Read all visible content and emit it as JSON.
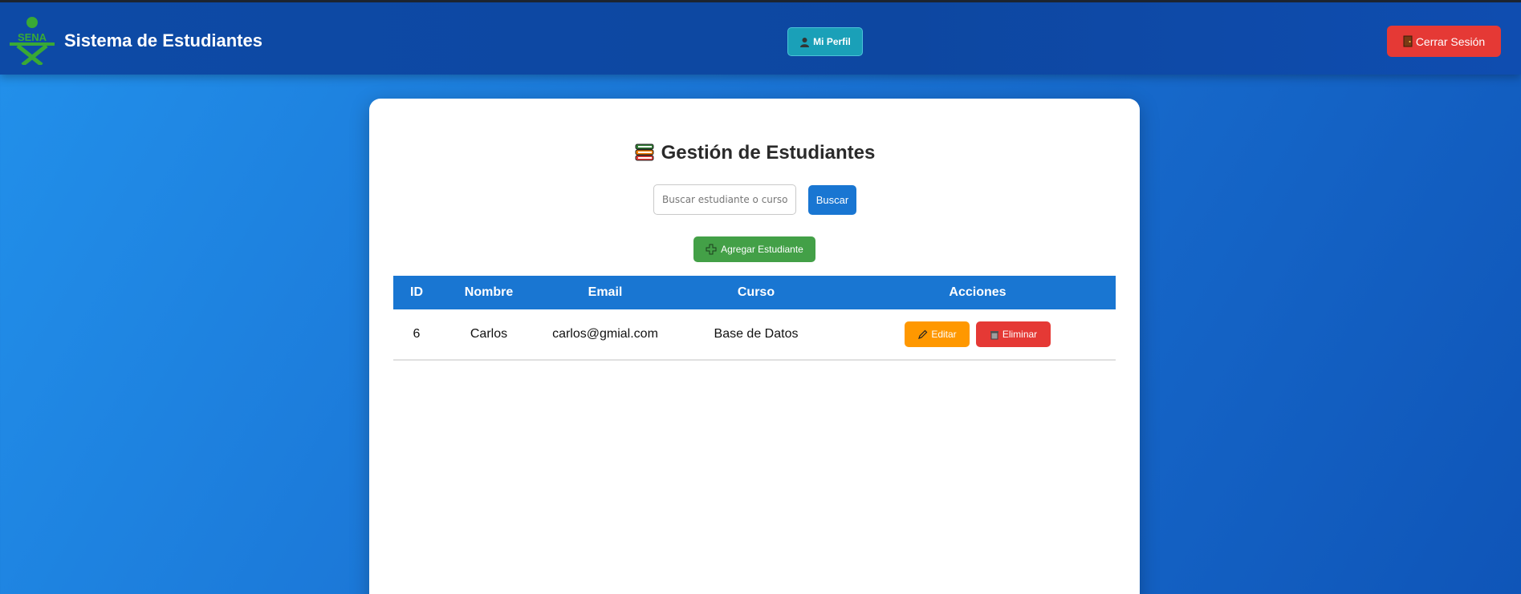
{
  "header": {
    "title": "Sistema de Estudiantes",
    "logo_text": "SENA",
    "profile_label": "Mi Perfil",
    "logout_label": "Cerrar Sesión"
  },
  "main": {
    "title": "Gestión de Estudiantes",
    "search": {
      "placeholder": "Buscar estudiante o curso",
      "value": ""
    },
    "search_button": "Buscar",
    "add_button": "Agregar Estudiante",
    "table": {
      "headers": [
        "ID",
        "Nombre",
        "Email",
        "Curso",
        "Acciones"
      ],
      "rows": [
        {
          "id": "6",
          "nombre": "Carlos",
          "email": "carlos@gmial.com",
          "curso": "Base de Datos"
        }
      ],
      "edit_label": "Editar",
      "delete_label": "Eliminar"
    }
  },
  "icons": {
    "profile": "person-icon",
    "logout": "door-icon",
    "title": "books-icon",
    "add": "plus-icon",
    "edit": "pencil-icon",
    "delete": "trash-icon"
  },
  "colors": {
    "header_bg": "#0d47a1",
    "primary": "#1976d2",
    "profile": "#1aa0b8",
    "danger": "#e53935",
    "success": "#43a047",
    "warning": "#ff9800",
    "logo_green": "#39a935"
  }
}
